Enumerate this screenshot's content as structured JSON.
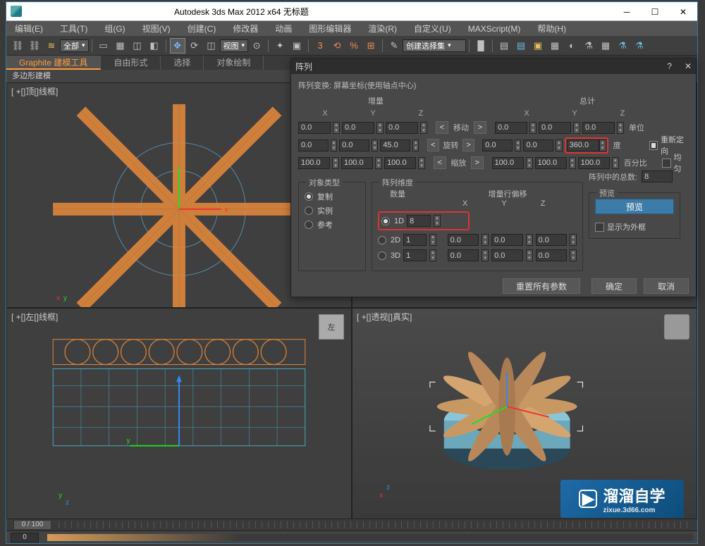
{
  "window": {
    "title": "Autodesk 3ds Max  2012 x64       无标题"
  },
  "menus": [
    "编辑(E)",
    "工具(T)",
    "组(G)",
    "视图(V)",
    "创建(C)",
    "修改器",
    "动画",
    "图形编辑器",
    "渲染(R)",
    "自定义(U)",
    "MAXScript(M)",
    "帮助(H)"
  ],
  "toolbar": {
    "layer_sel": "全部",
    "view_sel": "视图",
    "sel_filter": "创建选择集",
    "angle": "3"
  },
  "graphite": {
    "tabs": [
      "Graphite 建模工具",
      "自由形式",
      "选择",
      "对象绘制"
    ],
    "sub": "多边形建模"
  },
  "viewports": {
    "top": "[ +[]顶[]线框]",
    "left": "[ +[]左[]线框]",
    "persp": "[ +[]透视[]真实]",
    "left_cube": "左"
  },
  "dialog": {
    "title": "阵列",
    "subtitle": "阵列变换: 屏幕坐标(使用轴点中心)",
    "section_inc": "增量",
    "section_total": "总计",
    "cols": [
      "X",
      "Y",
      "Z"
    ],
    "rows": {
      "move": {
        "label": "移动",
        "l": [
          "0.0",
          "0.0",
          "0.0"
        ],
        "r": [
          "0.0",
          "0.0",
          "0.0"
        ],
        "unit": "单位"
      },
      "rotate": {
        "label": "旋转",
        "l": [
          "0.0",
          "0.0",
          "45.0"
        ],
        "r": [
          "0.0",
          "0.0",
          "360.0"
        ],
        "unit": "度"
      },
      "scale": {
        "label": "缩放",
        "l": [
          "100.0",
          "100.0",
          "100.0"
        ],
        "r": [
          "100.0",
          "100.0",
          "100.0"
        ],
        "unit": "百分比"
      }
    },
    "reorient": "重新定向",
    "uniform": "均匀",
    "obj_type": {
      "legend": "对象类型",
      "copy": "复制",
      "instance": "实例",
      "reference": "参考"
    },
    "dims": {
      "legend": "阵列维度",
      "count_hdr": "数量",
      "offset_hdr": "增量行偏移",
      "d1": {
        "lbl": "1D",
        "count": "8"
      },
      "d2": {
        "lbl": "2D",
        "count": "1",
        "x": "0.0",
        "y": "0.0",
        "z": "0.0"
      },
      "d3": {
        "lbl": "3D",
        "count": "1",
        "x": "0.0",
        "y": "0.0",
        "z": "0.0"
      }
    },
    "total_in_array": {
      "label": "阵列中的总数:",
      "value": "8"
    },
    "preview": {
      "legend": "预览",
      "btn": "预览",
      "wire": "显示为外框"
    },
    "buttons": {
      "reset": "重置所有参数",
      "ok": "确定",
      "cancel": "取消"
    }
  },
  "timeline": {
    "frame": "0 / 100"
  },
  "bottom": {
    "frame": "0"
  },
  "logo": {
    "brand": "溜溜自学",
    "sub": "zixue.3d66.com"
  }
}
